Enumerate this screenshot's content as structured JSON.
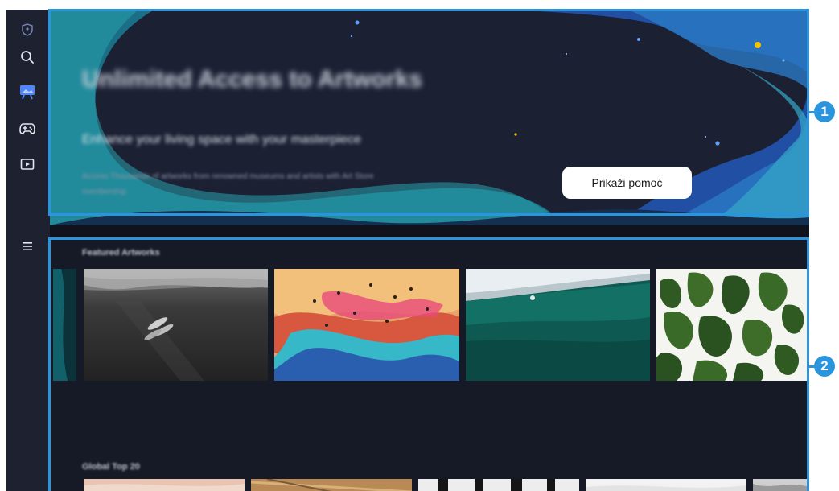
{
  "sidebar": {
    "icons": [
      "privacy-shield-icon",
      "search-icon",
      "art-easel-icon",
      "gamepad-icon",
      "media-play-icon",
      "menu-icon"
    ]
  },
  "banner": {
    "title": "Unlimited Access to Artworks",
    "subtitle": "Enhance your living space with your masterpiece",
    "description": "Access Thousands of artworks from renowned museums and artists with Art Store membership",
    "help_button": "Prikaži pomoć"
  },
  "sections": {
    "featured_title": "Featured Artworks",
    "global_top_title": "Global Top 20"
  },
  "callouts": {
    "one": "1",
    "two": "2"
  },
  "colors": {
    "highlight": "#2a95dd",
    "background": "#141722"
  }
}
